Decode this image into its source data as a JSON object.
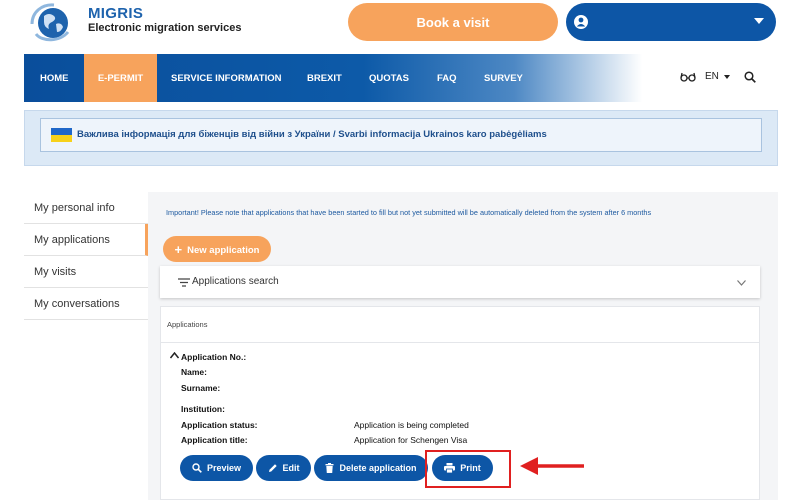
{
  "header": {
    "brand_title": "MIGRIS",
    "brand_subtitle": "Electronic migration services",
    "book_visit_label": "Book a visit"
  },
  "nav": {
    "items": [
      {
        "label": "HOME"
      },
      {
        "label": "E-PERMIT",
        "active": true
      },
      {
        "label": "SERVICE INFORMATION"
      },
      {
        "label": "BREXIT"
      },
      {
        "label": "QUOTAS"
      },
      {
        "label": "FAQ"
      },
      {
        "label": "SURVEY"
      }
    ],
    "language": "EN"
  },
  "notice": {
    "text": "Важлива інформація для біженців від війни з України / Svarbi informacija Ukrainos karo pabėgėliams"
  },
  "sidebar": {
    "items": [
      {
        "label": "My personal info"
      },
      {
        "label": "My applications",
        "active": true
      },
      {
        "label": "My visits"
      },
      {
        "label": "My conversations"
      }
    ]
  },
  "main": {
    "important_note": "Important! Please note that applications that have been started to fill but not yet submitted will be automatically deleted from the system after 6 months",
    "new_application_label": "New application",
    "applications_search_label": "Applications search",
    "applications_heading": "Applications",
    "application": {
      "number_label": "Application No.:",
      "name_label": "Name:",
      "surname_label": "Surname:",
      "institution_label": "Institution:",
      "status_label": "Application status:",
      "status_value": "Application is being completed",
      "title_label": "Application title:",
      "title_value": "Application for Schengen Visa"
    },
    "actions": {
      "preview": "Preview",
      "edit": "Edit",
      "delete": "Delete application",
      "print": "Print"
    }
  },
  "colors": {
    "primary": "#0d56a6",
    "accent": "#f7a35c",
    "highlight": "#e02020"
  }
}
